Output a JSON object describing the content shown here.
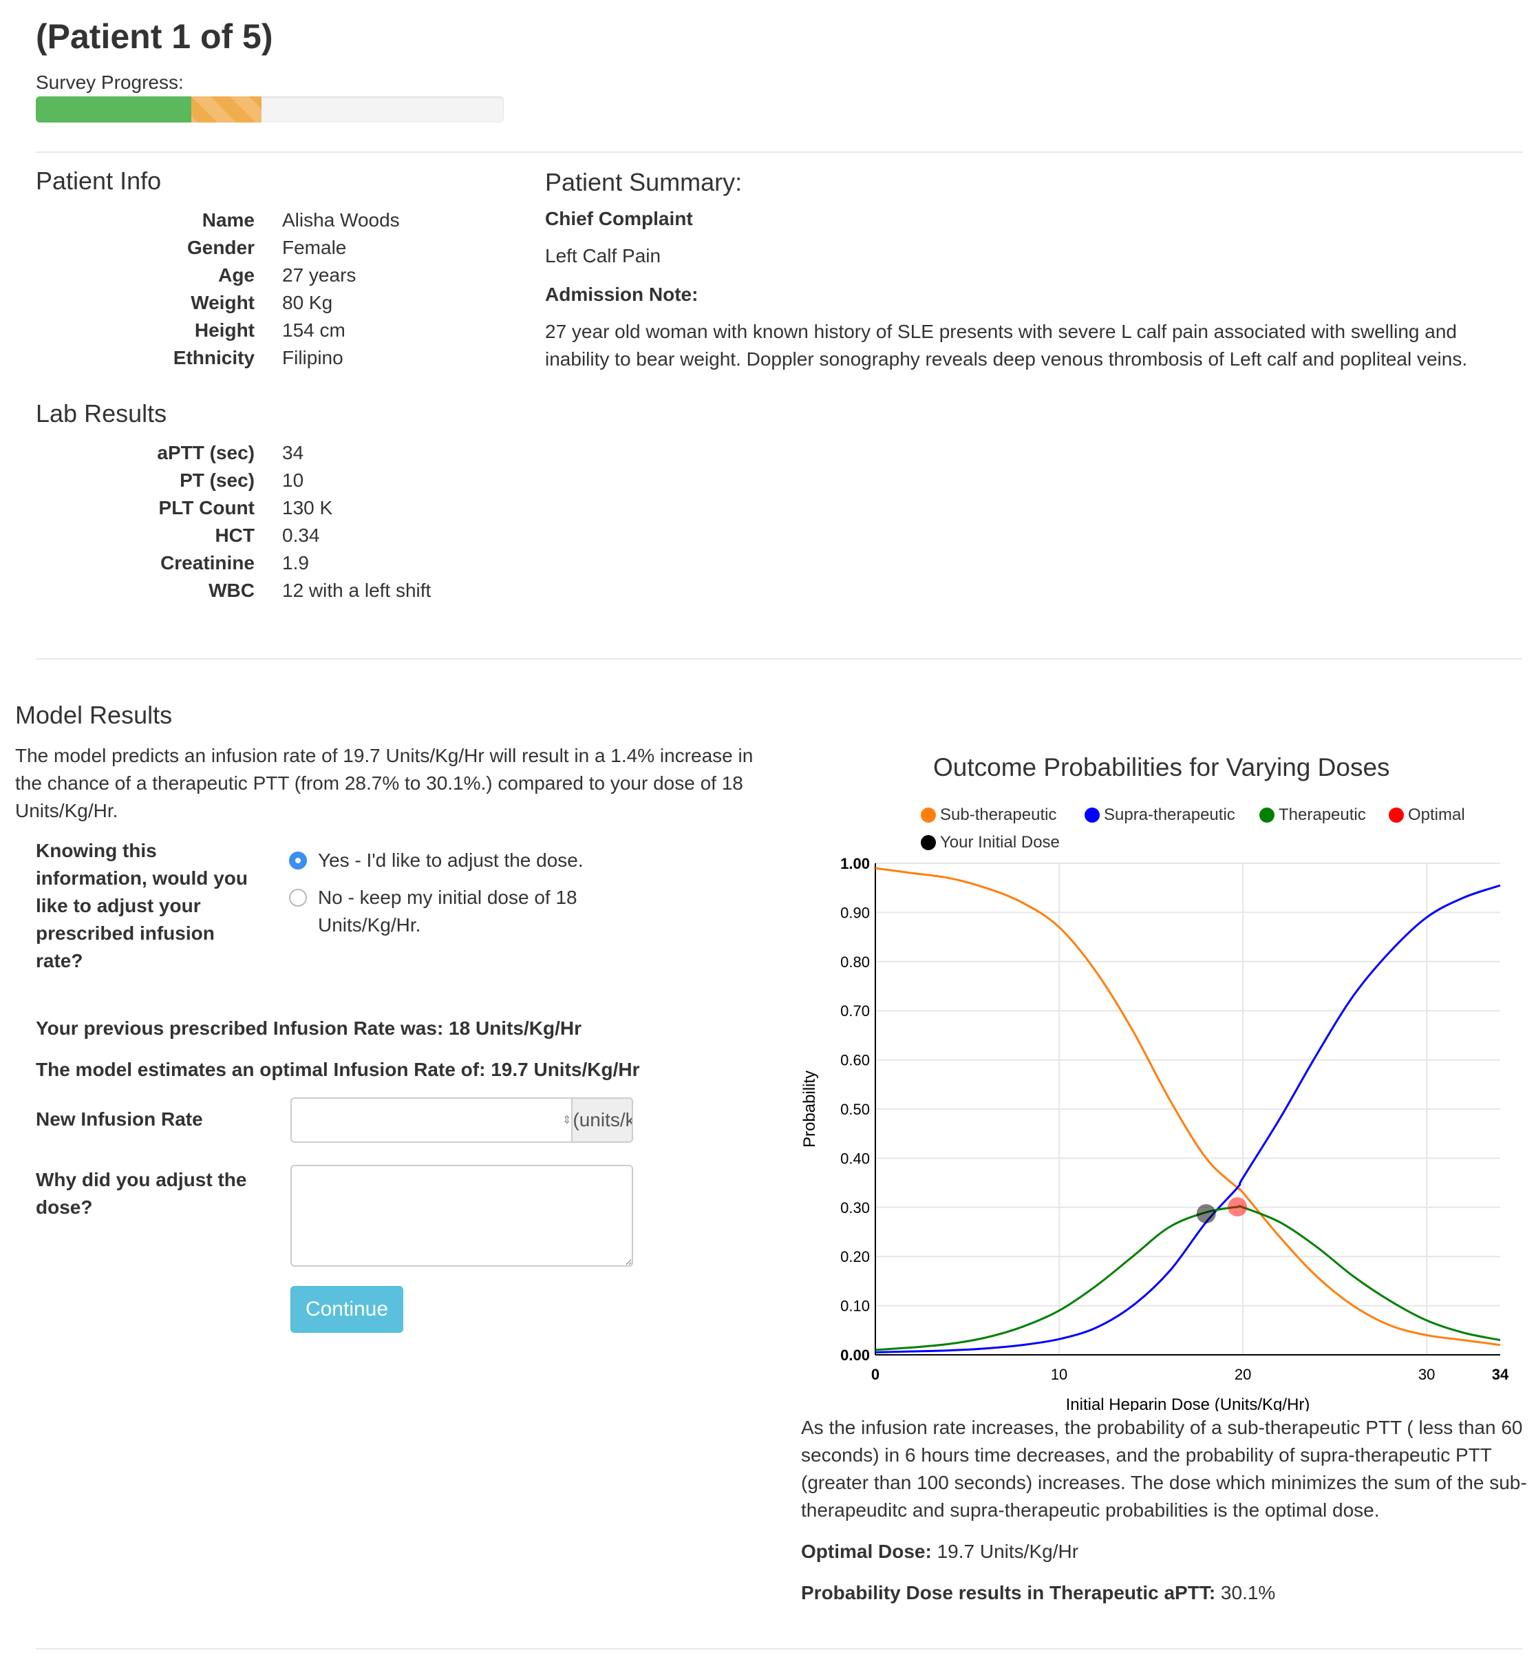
{
  "header": {
    "title": "(Patient 1 of 5)",
    "progress_label": "Survey Progress:",
    "progress": {
      "completed": 0.333,
      "current": 0.15
    },
    "colors": {
      "completed": "#5cb85c",
      "current": "#f0ad4e"
    }
  },
  "patient_info": {
    "heading": "Patient Info",
    "rows": [
      {
        "label": "Name",
        "value": "Alisha Woods"
      },
      {
        "label": "Gender",
        "value": "Female"
      },
      {
        "label": "Age",
        "value": "27 years"
      },
      {
        "label": "Weight",
        "value": "80 Kg"
      },
      {
        "label": "Height",
        "value": "154 cm"
      },
      {
        "label": "Ethnicity",
        "value": "Filipino"
      }
    ]
  },
  "lab_results": {
    "heading": "Lab Results",
    "rows": [
      {
        "label": "aPTT (sec)",
        "value": "34"
      },
      {
        "label": "PT (sec)",
        "value": "10"
      },
      {
        "label": "PLT Count",
        "value": "130 K"
      },
      {
        "label": "HCT",
        "value": "0.34"
      },
      {
        "label": "Creatinine",
        "value": "1.9"
      },
      {
        "label": "WBC",
        "value": "12 with a left shift"
      }
    ]
  },
  "summary": {
    "heading": "Patient Summary:",
    "chief_complaint_label": "Chief Complaint",
    "chief_complaint": "Left Calf Pain",
    "admission_note_label": "Admission Note:",
    "admission_note": "27 year old woman with known history of SLE presents with severe L calf pain associated with swelling and inability to bear weight. Doppler sonography reveals deep venous thrombosis of Left calf and popliteal veins."
  },
  "model": {
    "heading": "Model Results",
    "description": "The model predicts an infusion rate of 19.7 Units/Kg/Hr will result in a 1.4% increase in the chance of a therapeutic PTT (from 28.7% to 30.1%.) compared to your dose of 18 Units/Kg/Hr.",
    "question": "Knowing this information, would you like to adjust your prescribed infusion rate?",
    "options": [
      {
        "label": "Yes - I'd like to adjust the dose.",
        "selected": true
      },
      {
        "label": "No - keep my initial dose of 18 Units/Kg/Hr.",
        "selected": false
      }
    ],
    "previous_rate": "Your previous prescribed Infusion Rate was: 18 Units/Kg/Hr",
    "optimal_rate": "The model estimates an optimal Infusion Rate of: 19.7 Units/Kg/Hr",
    "new_rate_label": "New Infusion Rate",
    "new_rate_value": "",
    "new_rate_unit": "(units/kg/hr)",
    "why_label": "Why did you adjust the dose?",
    "why_value": "",
    "continue_label": "Continue",
    "continue_color": "#5bc0de"
  },
  "chart_data": {
    "type": "line",
    "title": "Outcome Probabilities for Varying Doses",
    "xlabel": "Initial Heparin Dose (Units/Kg/Hr)",
    "ylabel": "Probability",
    "xlim": [
      0,
      34
    ],
    "ylim": [
      0,
      1
    ],
    "x_ticks": [
      0,
      10,
      20,
      30,
      34
    ],
    "y_ticks": [
      "0.00",
      "0.10",
      "0.20",
      "0.30",
      "0.40",
      "0.50",
      "0.60",
      "0.70",
      "0.80",
      "0.90",
      "1.00"
    ],
    "grid": true,
    "legend_position": "top",
    "legend": [
      "Sub-therapeutic",
      "Supra-therapeutic",
      "Therapeutic",
      "Optimal",
      "Your Initial Dose"
    ],
    "x": [
      0,
      2,
      4,
      6,
      8,
      10,
      12,
      14,
      16,
      18,
      19.7,
      20,
      22,
      24,
      26,
      28,
      30,
      32,
      34
    ],
    "series": [
      {
        "name": "Sub-therapeutic",
        "color": "#ff7f0e",
        "values": [
          0.99,
          0.98,
          0.97,
          0.95,
          0.92,
          0.87,
          0.78,
          0.66,
          0.52,
          0.4,
          0.34,
          0.33,
          0.24,
          0.16,
          0.1,
          0.06,
          0.04,
          0.03,
          0.02
        ]
      },
      {
        "name": "Supra-therapeutic",
        "color": "#0000ff",
        "values": [
          0.005,
          0.007,
          0.009,
          0.013,
          0.02,
          0.032,
          0.055,
          0.1,
          0.17,
          0.27,
          0.34,
          0.36,
          0.48,
          0.61,
          0.73,
          0.82,
          0.89,
          0.93,
          0.955
        ]
      },
      {
        "name": "Therapeutic",
        "color": "#008000",
        "values": [
          0.01,
          0.015,
          0.022,
          0.035,
          0.057,
          0.09,
          0.14,
          0.2,
          0.26,
          0.29,
          0.301,
          0.3,
          0.27,
          0.22,
          0.16,
          0.11,
          0.07,
          0.045,
          0.03
        ]
      }
    ],
    "points": [
      {
        "name": "Your Initial Dose",
        "x": 18,
        "y": 0.287,
        "color": "#000000"
      },
      {
        "name": "Optimal",
        "x": 19.7,
        "y": 0.301,
        "color": "#ff0000"
      }
    ]
  },
  "chart_notes": {
    "explanation": "As the infusion rate increases, the probability of a sub-therapeutic PTT ( less than 60 seconds) in 6 hours time decreases, and the probability of supra-therapeutic PTT (greater than 100 seconds) increases. The dose which minimizes the sum of the sub-therapeuditc and supra-therapeutic probabilities is the optimal dose.",
    "optimal_dose_label": "Optimal Dose:",
    "optimal_dose_value": "19.7 Units/Kg/Hr",
    "probability_label": "Probability Dose results in Therapeutic aPTT:",
    "probability_value": "30.1%"
  }
}
